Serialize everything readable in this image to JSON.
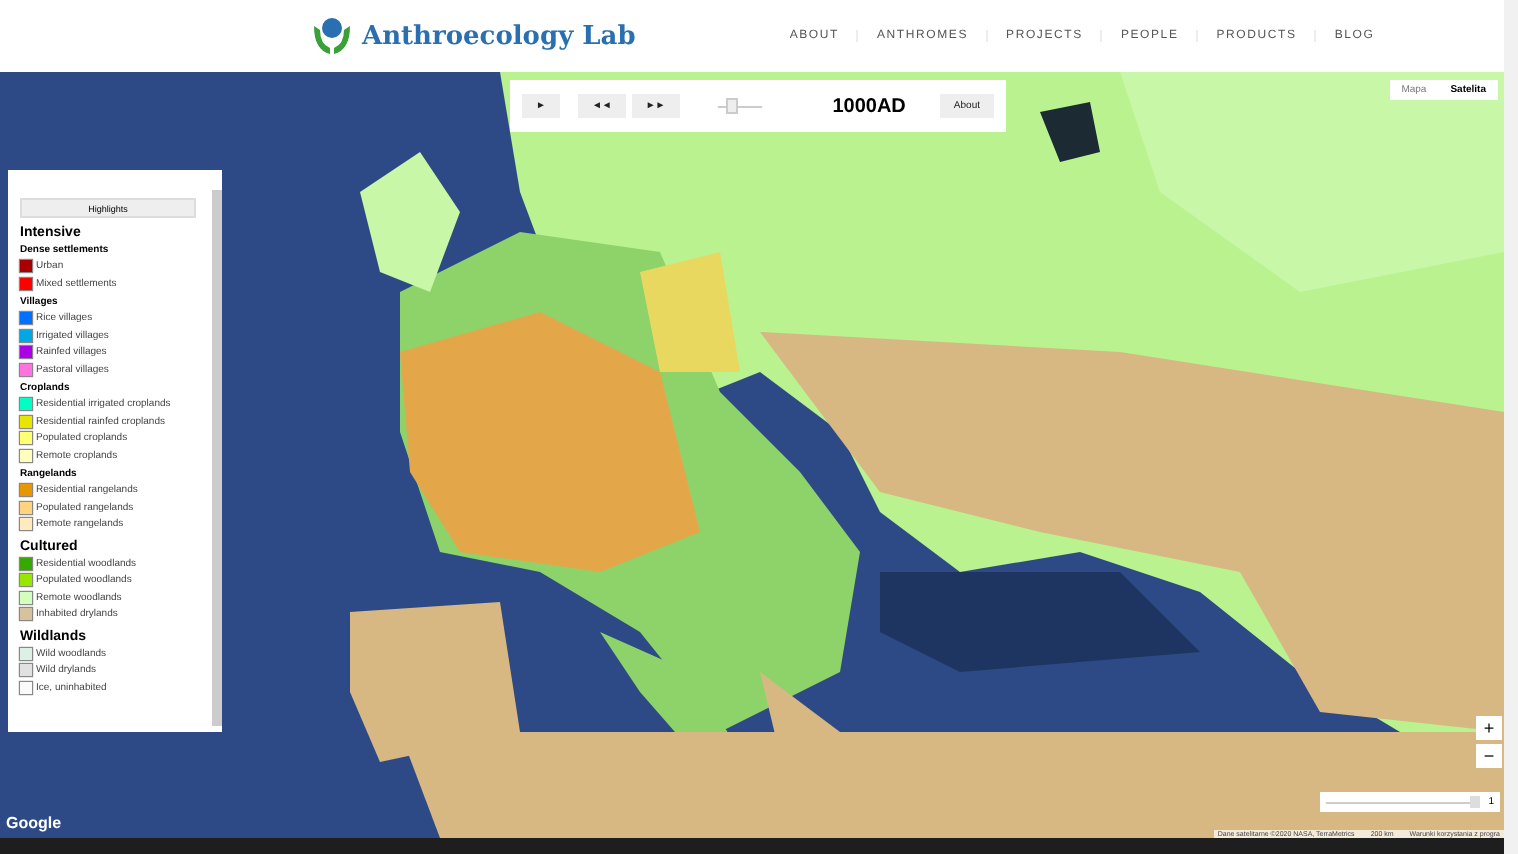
{
  "header": {
    "logo_text": "Anthroecology Lab",
    "nav": [
      {
        "label": "ABOUT"
      },
      {
        "label": "ANTHROMES"
      },
      {
        "label": "PROJECTS"
      },
      {
        "label": "PEOPLE"
      },
      {
        "label": "PRODUCTS"
      },
      {
        "label": "BLOG"
      }
    ]
  },
  "controls": {
    "buttons": [
      "►",
      "◄◄",
      "►►"
    ],
    "timeline": {
      "level": 0.3
    },
    "year": "1000AD",
    "about": "About"
  },
  "map_type": [
    {
      "label": "Mapa",
      "selected": false
    },
    {
      "label": "Satelita",
      "selected": true
    }
  ],
  "legend": {
    "dropdown": "Highlights",
    "groups": [
      {
        "title": "Intensive",
        "subgroups": [
          {
            "title": "Dense settlements",
            "items": [
              {
                "label": "Urban",
                "color": "#a80000"
              },
              {
                "label": "Mixed settlements",
                "color": "#ff0000"
              }
            ]
          },
          {
            "title": "Villages",
            "items": [
              {
                "label": "Rice villages",
                "color": "#0070ff"
              },
              {
                "label": "Irrigated villages",
                "color": "#00a9e6"
              },
              {
                "label": "Rainfed villages",
                "color": "#a900e6"
              },
              {
                "label": "Pastoral villages",
                "color": "#ff73df"
              }
            ]
          },
          {
            "title": "Croplands",
            "items": [
              {
                "label": "Residential irrigated croplands",
                "color": "#00ffc5"
              },
              {
                "label": "Residential rainfed croplands",
                "color": "#e6e600"
              },
              {
                "label": "Populated croplands",
                "color": "#ffff73"
              },
              {
                "label": "Remote croplands",
                "color": "#ffffbe"
              }
            ]
          },
          {
            "title": "Rangelands",
            "items": [
              {
                "label": "Residential rangelands",
                "color": "#e69800"
              },
              {
                "label": "Populated rangelands",
                "color": "#ffd37f"
              },
              {
                "label": "Remote rangelands",
                "color": "#ffebbe"
              }
            ]
          }
        ]
      },
      {
        "title": "Cultured",
        "subgroups": [
          {
            "items": [
              {
                "label": "Residential woodlands",
                "color": "#38a800"
              },
              {
                "label": "Populated woodlands",
                "color": "#98e600"
              },
              {
                "label": "Remote woodlands",
                "color": "#d3ffbe"
              },
              {
                "label": "Inhabited drylands",
                "color": "#d7c29e"
              }
            ]
          }
        ]
      },
      {
        "title": "Wildlands",
        "subgroups": [
          {
            "items": [
              {
                "label": "Wild woodlands",
                "color": "#dcf0e6"
              },
              {
                "label": "Wild drylands",
                "color": "#e1e1e1"
              },
              {
                "label": "Ice, uninhabited",
                "color": "#fafafa"
              }
            ]
          }
        ]
      }
    ]
  },
  "opacity": {
    "level": 1,
    "reading": "1"
  },
  "zoom": [
    "+",
    "−"
  ],
  "google": "Google",
  "attribution": [
    "Dane satelitarne ©2020 NASA, TerraMetrics",
    "200 km",
    "Warunki korzystania z progra"
  ]
}
